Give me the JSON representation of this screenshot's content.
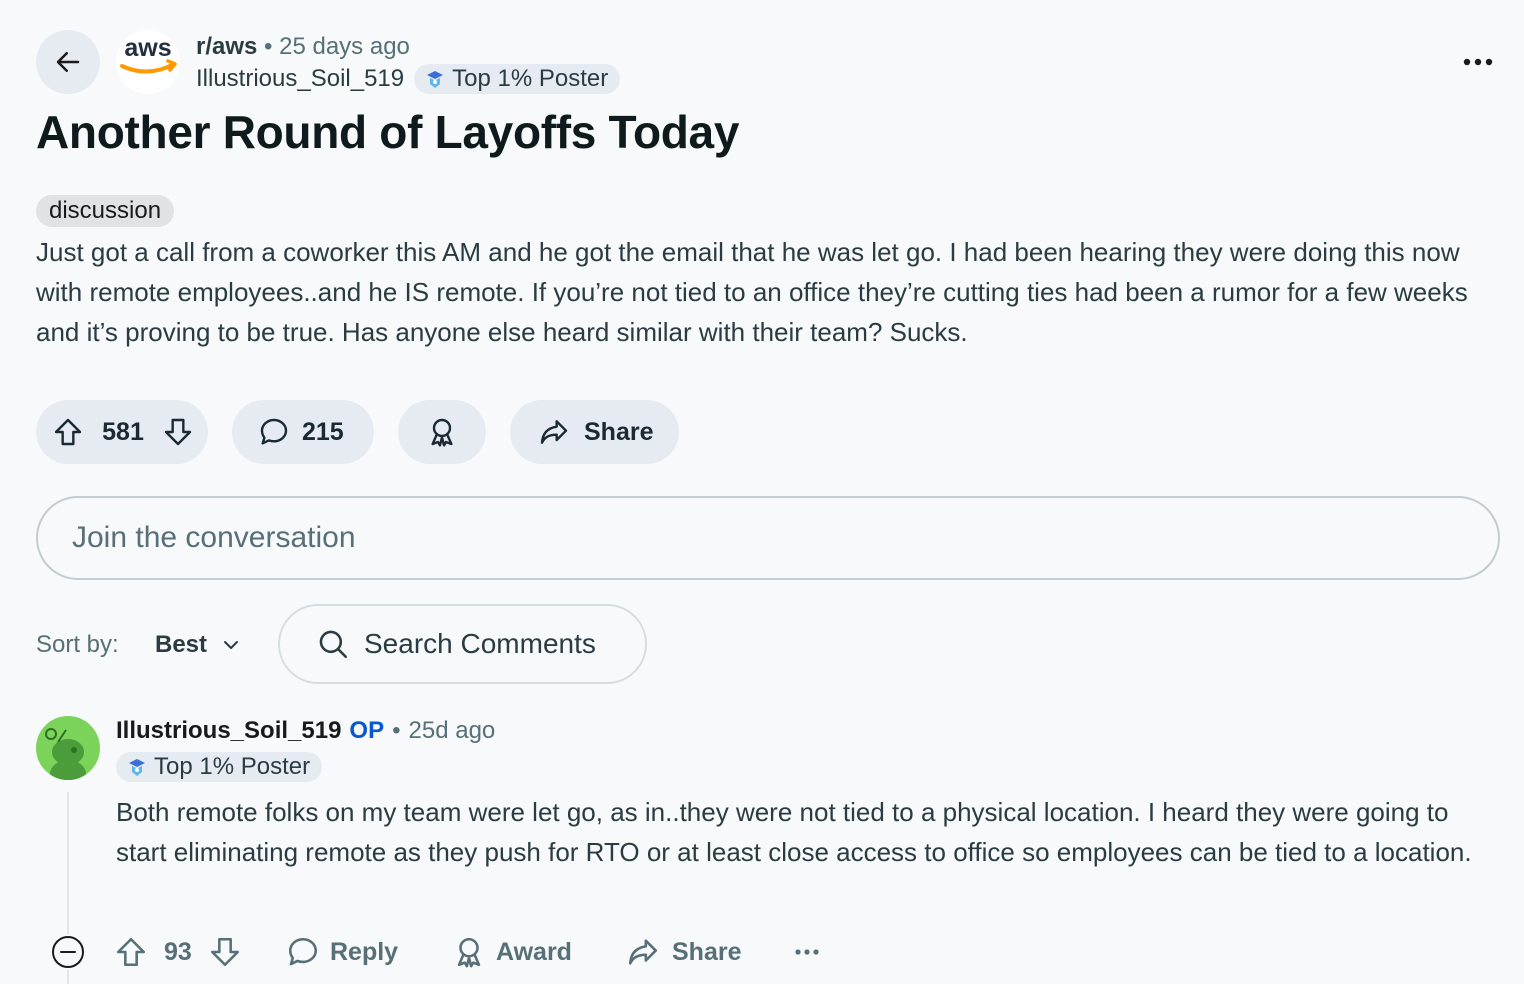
{
  "post": {
    "subreddit": "r/aws",
    "subreddit_logo_text": "aws",
    "separator": "•",
    "time_ago": "25 days ago",
    "author": "Illustrious_Soil_519",
    "author_flair": "Top 1% Poster",
    "title": "Another Round of Layoffs Today",
    "tag": "discussion",
    "body": "Just got a call from a coworker this AM and he got the email that he was let go. I had been hearing they were doing this now with remote employees..and he IS remote. If you’re not tied to an office they’re cutting ties had been a rumor for a few weeks and it’s proving to be true. Has anyone else heard similar with their team? Sucks.",
    "votes": "581",
    "comments": "215",
    "share_label": "Share"
  },
  "composer": {
    "placeholder": "Join the conversation"
  },
  "sort": {
    "label": "Sort by:",
    "value": "Best"
  },
  "search": {
    "placeholder": "Search Comments"
  },
  "comment": {
    "author": "Illustrious_Soil_519",
    "op_badge": "OP",
    "separator": "•",
    "time_ago": "25d ago",
    "flair": "Top 1% Poster",
    "body": "Both remote folks on my team were let go, as in..they were not tied to a physical location. I heard they were going to start eliminating remote as they push for RTO or at least close access to office so employees can be tied to a location.",
    "votes": "93",
    "reply_label": "Reply",
    "award_label": "Award",
    "share_label": "Share"
  },
  "colors": {
    "background": "#f7f9fb",
    "pill": "#e5ebf1",
    "op_blue": "#0a58d0",
    "aws_orange": "#ff9900",
    "avatar_green": "#7bd35a"
  },
  "icons": [
    "back-arrow-icon",
    "more-icon",
    "upvote-icon",
    "downvote-icon",
    "comment-icon",
    "award-icon",
    "share-icon",
    "search-icon",
    "chevron-down-icon",
    "collapse-icon",
    "flair-icon"
  ]
}
